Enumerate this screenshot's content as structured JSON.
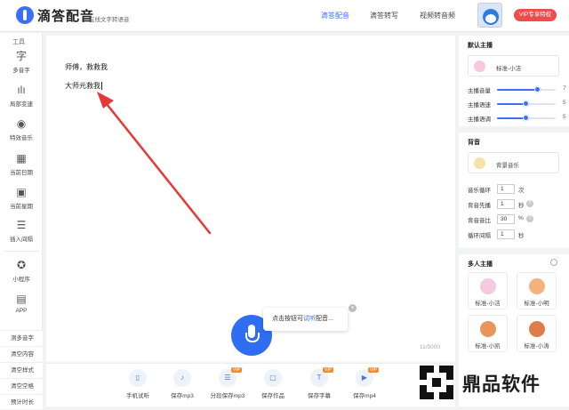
{
  "header": {
    "brand": "滴答配音",
    "slogan": "在线文字转语音",
    "nav": [
      "滴答配音",
      "滴答转写",
      "视频转音频"
    ],
    "vip_button": "VIP专享特权"
  },
  "left_tools": {
    "heading": "工具",
    "items": [
      {
        "label": "多音字",
        "icon": "polyphone-icon"
      },
      {
        "label": "局部变速",
        "icon": "waveform-icon"
      },
      {
        "label": "特效音乐",
        "icon": "music-effect-icon"
      },
      {
        "label": "当前日期",
        "icon": "calendar-icon"
      },
      {
        "label": "当前星期",
        "icon": "week-icon"
      },
      {
        "label": "插入间隔",
        "icon": "pause-insert-icon"
      },
      {
        "label": "小程序",
        "icon": "miniprogram-icon"
      },
      {
        "label": "APP",
        "icon": "app-icon"
      }
    ],
    "quick_actions": [
      "测多音字",
      "清空内容",
      "清空样式",
      "清空空格",
      "预计时长"
    ]
  },
  "editor": {
    "line1": "师傅，救救我",
    "line2": "大师元救我",
    "counter": "11/5000",
    "tip_prefix": "点击按钮可",
    "tip_highlight": "试听",
    "tip_suffix": "配音..."
  },
  "bottom_actions": [
    {
      "label": "手机试听",
      "icon": "phone-icon",
      "vip": false
    },
    {
      "label": "保存mp3",
      "icon": "mp3-icon",
      "vip": false
    },
    {
      "label": "分段保存mp3",
      "icon": "list-icon",
      "vip": true
    },
    {
      "label": "保存作品",
      "icon": "save-work-icon",
      "vip": false
    },
    {
      "label": "保存字幕",
      "icon": "subtitle-icon",
      "vip": true
    },
    {
      "label": "保存mp4",
      "icon": "mp4-icon",
      "vip": true
    }
  ],
  "vip_tag": "VIP",
  "right_panel": {
    "default_voice_title": "默认主播",
    "default_voice_name": "标准-小洁",
    "sliders": [
      {
        "label": "主播音量",
        "value": "7",
        "fraction": 0.7
      },
      {
        "label": "主播语速",
        "value": "5",
        "fraction": 0.5
      },
      {
        "label": "主播语调",
        "value": "5",
        "fraction": 0.5
      }
    ],
    "bg_title": "背音",
    "bg_name": "背景音乐",
    "bg_rows": [
      {
        "label": "音乐循环",
        "value": "1",
        "unit": "次",
        "help": false
      },
      {
        "label": "背音先播",
        "value": "1",
        "unit": "秒",
        "help": true
      },
      {
        "label": "背音音比",
        "value": "30",
        "unit": "%",
        "help": true
      },
      {
        "label": "循环间隔",
        "value": "1",
        "unit": "秒",
        "help": false
      }
    ],
    "multi_title": "多人主播",
    "multi_voices": [
      "标准-小洁",
      "标准-小明",
      "标准-小凯",
      "标准-小涛"
    ]
  },
  "watermark": {
    "text": "鼎品软件"
  },
  "colors": {
    "accent": "#3b6ff5",
    "vip": "#ef4c4c",
    "arrow": "#e53935"
  }
}
